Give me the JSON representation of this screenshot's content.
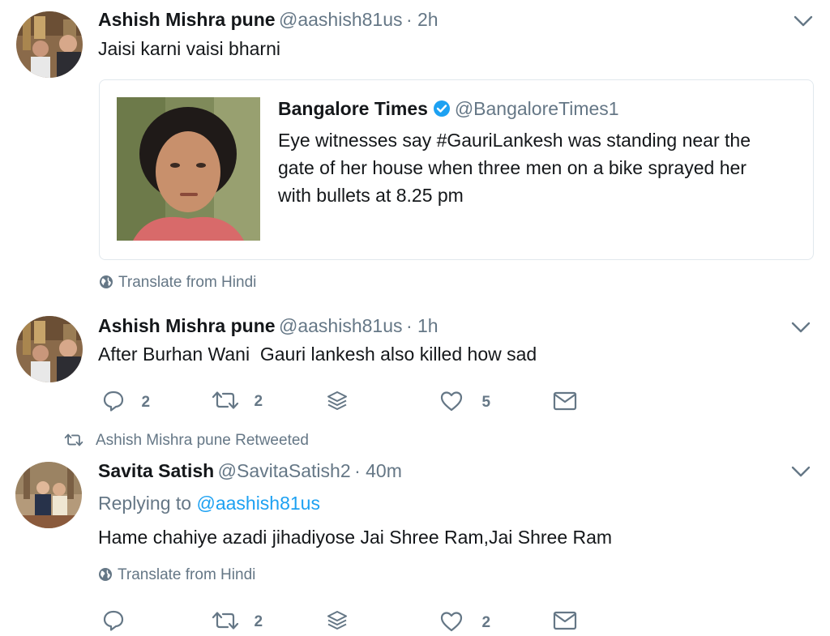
{
  "tweets": [
    {
      "name": "Ashish Mishra pune",
      "handle": "@aashish81us",
      "time": "· 2h",
      "text": "Jaisi karni vaisi bharni",
      "quote": {
        "name": "Bangalore Times",
        "handle": "@BangaloreTimes1",
        "text_lines": [
          "Eye witnesses say #GauriLankesh was standing near the",
          "gate of her house when three men on a bike sprayed her",
          "with bullets at 8.25 pm"
        ]
      },
      "translate": "Translate from Hindi"
    },
    {
      "name": "Ashish Mishra pune",
      "handle": "@aashish81us",
      "time": "· 1h",
      "text": "After Burhan Wani  Gauri lankesh also killed how sad",
      "actions": {
        "replies": "2",
        "retweets": "2",
        "likes": "5"
      }
    },
    {
      "retweet_context": "Ashish Mishra pune Retweeted",
      "name": "Savita Satish",
      "handle": "@SavitaSatish2",
      "time": "· 40m",
      "replying_prefix": "Replying to",
      "replying_to": "@aashish81us",
      "text": "Hame chahiye azadi jihadiyose Jai Shree Ram,Jai Shree Ram",
      "translate": "Translate from Hindi",
      "actions": {
        "replies": "",
        "retweets": "2",
        "likes": "2"
      }
    }
  ],
  "colors": {
    "text": "#14171a",
    "secondary": "#657786",
    "link": "#1da1f2",
    "verified": "#1da1f2",
    "border": "#e1e8ed"
  },
  "icons": [
    "chevron-down-icon",
    "reply-icon",
    "retweet-icon",
    "stack-icon",
    "heart-icon",
    "mail-icon",
    "globe-icon",
    "verified-icon"
  ]
}
